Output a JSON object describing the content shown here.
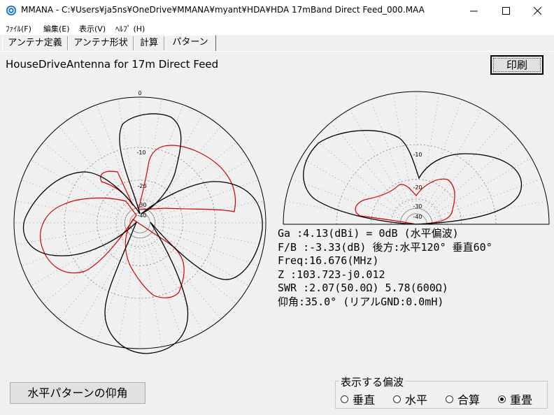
{
  "window": {
    "title": "MMANA - C:¥Users¥ja5ns¥OneDrive¥MMANA¥myant¥HDA¥HDA 17mBand Direct Feed_000.MAA"
  },
  "menu": [
    "ﾌｧｲﾙ(F)",
    "編集(E)",
    "表示(V)",
    "ﾍﾙﾌﾟ (H)"
  ],
  "tabs": [
    "アンテナ定義",
    "アンテナ形状",
    "計算",
    "パターン"
  ],
  "active_tab": "パターン",
  "antenna_description": "HouseDriveAntenna for 17m Direct Feed",
  "print_button": "印刷",
  "elevation_button": "水平パターンの仰角",
  "scale_labels": {
    "top": "0",
    "ring10": "-10",
    "ring20": "-20",
    "ring30": "-30",
    "ring40": "-40"
  },
  "readout": {
    "ga": "Ga  :4.13(dBi) = 0dB  (水平偏波)",
    "fb": "F/B :-3.33(dB) 後方:水平120°  垂直60°",
    "freq": "Freq:16.676(MHz)",
    "z": "Z   :103.723-j0.012",
    "swr": "SWR :2.07(50.0Ω) 5.78(600Ω)",
    "elev": "仰角:35.0° (リアルGND:0.0mH)"
  },
  "polarization": {
    "label": "表示する偏波",
    "options": [
      "垂直",
      "水平",
      "合算",
      "重畳"
    ],
    "selected": "重畳"
  },
  "colors": {
    "total_pattern": "#000000",
    "horizontal_pattern": "#d00000",
    "grid": "#808080"
  },
  "icons": {
    "app": "mmana-globe-icon",
    "minimize": "minimize-icon",
    "maximize": "maximize-icon",
    "close": "close-icon"
  }
}
